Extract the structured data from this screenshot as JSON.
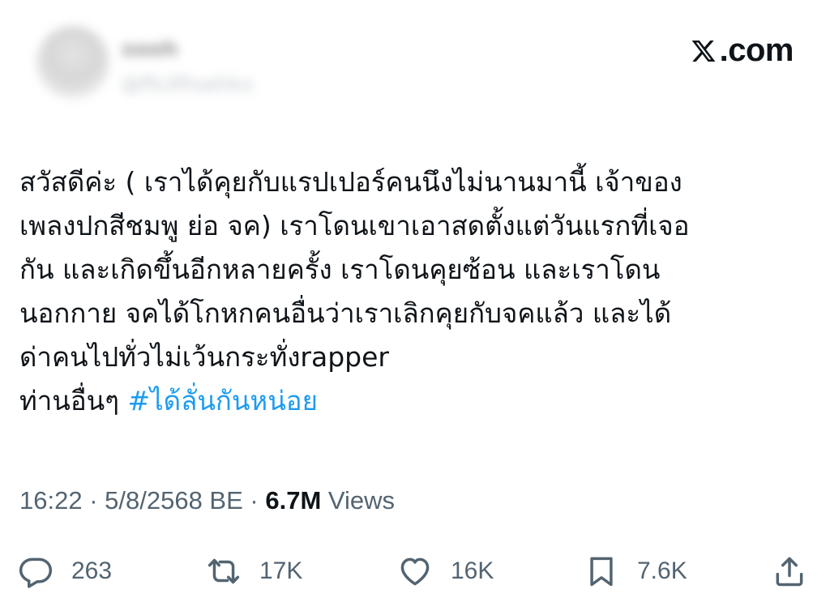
{
  "header": {
    "display_name": "sooh",
    "handle": "@ffs3fhsehkx",
    "brand": ".com"
  },
  "tweet": {
    "lines": [
      "สวัสดีค่ะ  ( เราได้คุยกับแรปเปอร์คนนึงไม่นานมานี้ เจ้าของ",
      "เพลงปกสีชมพู ย่อ จค) เราโดนเขาเอาสดตั้งแต่วันแรกที่เจอ",
      "กัน และเกิดขึ้นอีกหลายครั้ง เราโดนคุยซ้อน และเราโดน",
      "นอกกาย จคได้โกหกคนอื่นว่าเราเลิกคุยกับจคแล้ว และได้",
      "ด่าคนไปทั่วไม่เว้นกระทั่งrapper"
    ],
    "last_line_prefix": "ท่านอื่นๆ ",
    "hashtag": "#ได้ลั่นกันหน่อย"
  },
  "meta": {
    "time": "16:22",
    "sep1": " · ",
    "date": "5/8/2568 BE",
    "sep2": " · ",
    "views_count": "6.7M",
    "views_label": " Views"
  },
  "actions": {
    "replies": "263",
    "reposts": "17K",
    "likes": "16K",
    "bookmarks": "7.6K"
  },
  "icons": [
    "reply-icon",
    "repost-icon",
    "like-icon",
    "bookmark-icon",
    "share-icon",
    "x-logo-icon"
  ],
  "colors": {
    "text": "#0f1419",
    "secondary": "#536471",
    "link": "#1d9bf0"
  }
}
